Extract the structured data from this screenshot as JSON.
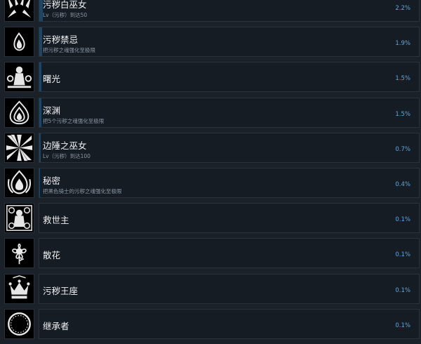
{
  "achievements": [
    {
      "title": "污秽白巫女",
      "desc": "Lv（污秽）到达50",
      "percent_label": "2.2%",
      "percent": 2.2,
      "icon": "white-witch-icon"
    },
    {
      "title": "污秽禁忌",
      "desc": "把污秽之魂强化至极限",
      "percent_label": "1.9%",
      "percent": 1.9,
      "icon": "soul-flame-icon"
    },
    {
      "title": "曙光",
      "desc": "",
      "percent_label": "1.5%",
      "percent": 1.5,
      "icon": "dawn-girl-icon"
    },
    {
      "title": "深渊",
      "desc": "把5个污秽之魂强化至极限",
      "percent_label": "1.5%",
      "percent": 1.5,
      "icon": "abyss-flame-icon"
    },
    {
      "title": "边陲之巫女",
      "desc": "Lv（污秽）到达100",
      "percent_label": "0.7%",
      "percent": 0.7,
      "icon": "burst-icon"
    },
    {
      "title": "秘密",
      "desc": "把黑色骑士的污秽之魂强化至极限",
      "percent_label": "0.4%",
      "percent": 0.4,
      "icon": "dark-flame-icon"
    },
    {
      "title": "救世主",
      "desc": "",
      "percent_label": "0.1%",
      "percent": 0.1,
      "icon": "savior-icon"
    },
    {
      "title": "散花",
      "desc": "",
      "percent_label": "0.1%",
      "percent": 0.1,
      "icon": "flower-icon"
    },
    {
      "title": "污秽王座",
      "desc": "",
      "percent_label": "0.1%",
      "percent": 0.1,
      "icon": "throne-crown-icon"
    },
    {
      "title": "继承者",
      "desc": "",
      "percent_label": "0.1%",
      "percent": 0.1,
      "icon": "ring-icon"
    }
  ],
  "colors": {
    "accent": "#5aa8e0",
    "bar": "#1f4562",
    "background": "#1b2129",
    "card": "#161c24"
  }
}
